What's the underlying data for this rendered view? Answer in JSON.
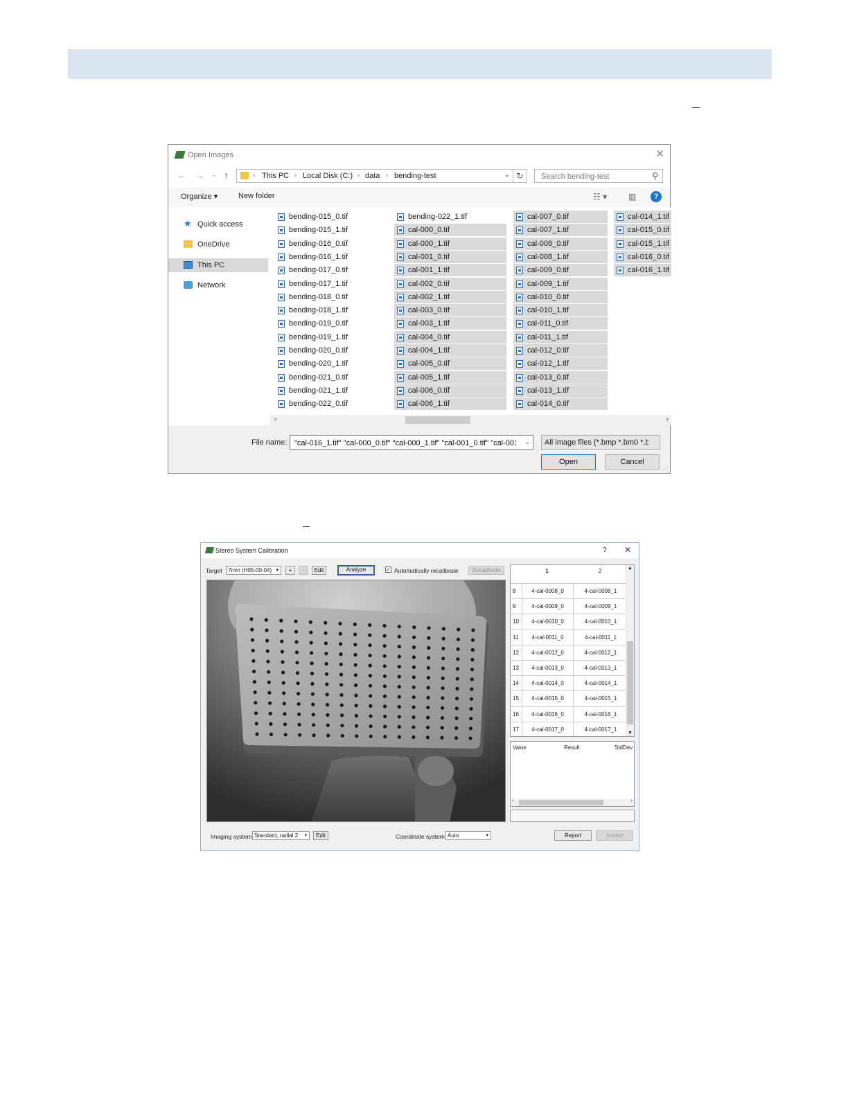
{
  "open_dialog": {
    "title": "Open Images",
    "close": "✕",
    "nav": {
      "back": "←",
      "forward": "→",
      "recent": "⌄",
      "up": "↑"
    },
    "breadcrumb": [
      "This PC",
      "Local Disk (C:)",
      "data",
      "bending-test"
    ],
    "search_placeholder": "Search bending-test",
    "toolbar": {
      "organize": "Organize ▾",
      "new_folder": "New folder"
    },
    "nav_pane": [
      {
        "label": "Quick access",
        "icon": "star-icon"
      },
      {
        "label": "OneDrive",
        "icon": "folder-icon"
      },
      {
        "label": "This PC",
        "icon": "computer-icon",
        "selected": true
      },
      {
        "label": "Network",
        "icon": "network-icon"
      }
    ],
    "columns": [
      {
        "files": [
          "bending-015_0.tif",
          "bending-015_1.tif",
          "bending-016_0.tif",
          "bending-016_1.tif",
          "bending-017_0.tif",
          "bending-017_1.tif",
          "bending-018_0.tif",
          "bending-018_1.tif",
          "bending-019_0.tif",
          "bending-019_1.tif",
          "bending-020_0.tif",
          "bending-020_1.tif",
          "bending-021_0.tif",
          "bending-021_1.tif",
          "bending-022_0.tif"
        ],
        "sel_from": 99
      },
      {
        "files": [
          "bending-022_1.tif",
          "cal-000_0.tif",
          "cal-000_1.tif",
          "cal-001_0.tif",
          "cal-001_1.tif",
          "cal-002_0.tif",
          "cal-002_1.tif",
          "cal-003_0.tif",
          "cal-003_1.tif",
          "cal-004_0.tif",
          "cal-004_1.tif",
          "cal-005_0.tif",
          "cal-005_1.tif",
          "cal-006_0.tif",
          "cal-006_1.tif"
        ],
        "sel_from": 1
      },
      {
        "files": [
          "cal-007_0.tif",
          "cal-007_1.tif",
          "cal-008_0.tif",
          "cal-008_1.tif",
          "cal-009_0.tif",
          "cal-009_1.tif",
          "cal-010_0.tif",
          "cal-010_1.tif",
          "cal-011_0.tif",
          "cal-011_1.tif",
          "cal-012_0.tif",
          "cal-012_1.tif",
          "cal-013_0.tif",
          "cal-013_1.tif",
          "cal-014_0.tif"
        ],
        "sel_from": 0
      },
      {
        "files": [
          "cal-014_1.tif",
          "cal-015_0.tif",
          "cal-015_1.tif",
          "cal-016_0.tif",
          "cal-016_1.tif"
        ],
        "sel_from": 0
      }
    ],
    "file_name_label": "File name:",
    "file_name_value": "\"cal-016_1.tif\" \"cal-000_0.tif\" \"cal-000_1.tif\" \"cal-001_0.tif\" \"cal-001_1",
    "file_type": "All image files (*.bmp *.bm0 *.b",
    "open_button": "Open",
    "cancel_button": "Cancel"
  },
  "calib_dialog": {
    "title": "Stereo System Calibration",
    "help": "?",
    "close": "✕",
    "target_label": "Target",
    "target_value": "7mm (H95-00-04)",
    "plus": "+",
    "minus": "-",
    "edit": "Edit",
    "analyze": "Analyze",
    "auto_recal_label": "Automatically recalibrate",
    "auto_recal_checked": true,
    "recalibrate": "Recalibrate",
    "grid_headers": [
      "1",
      "2"
    ],
    "grid_rows": [
      {
        "n": "8",
        "c1": "4-cal-0008_0",
        "c2": "4-cal-0008_1"
      },
      {
        "n": "9",
        "c1": "4-cal-0009_0",
        "c2": "4-cal-0009_1"
      },
      {
        "n": "10",
        "c1": "4-cal-0010_0",
        "c2": "4-cal-0010_1"
      },
      {
        "n": "11",
        "c1": "4-cal-0011_0",
        "c2": "4-cal-0011_1"
      },
      {
        "n": "12",
        "c1": "4-cal-0012_0",
        "c2": "4-cal-0012_1"
      },
      {
        "n": "13",
        "c1": "4-cal-0013_0",
        "c2": "4-cal-0013_1"
      },
      {
        "n": "14",
        "c1": "4-cal-0014_0",
        "c2": "4-cal-0014_1"
      },
      {
        "n": "15",
        "c1": "4-cal-0015_0",
        "c2": "4-cal-0015_1"
      },
      {
        "n": "16",
        "c1": "4-cal-0016_0",
        "c2": "4-cal-0016_1"
      },
      {
        "n": "17",
        "c1": "4-cal-0017_0",
        "c2": "4-cal-0017_1"
      }
    ],
    "result_headers": [
      "Value",
      "Result",
      "StdDev"
    ],
    "imaging_label": "Imaging system",
    "imaging_value": "Standard, radial 2",
    "imaging_edit": "Edit",
    "coord_label": "Coordinate system",
    "coord_value": "Auto",
    "report": "Report",
    "accept": "Accept"
  }
}
